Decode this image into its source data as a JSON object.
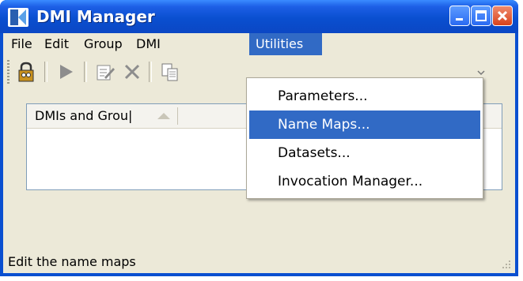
{
  "window": {
    "title": "DMI Manager"
  },
  "menubar": {
    "items": [
      "File",
      "Edit",
      "Group",
      "DMI",
      "Utilities"
    ],
    "active": "Utilities"
  },
  "table": {
    "column_header": "DMIs and Grou|"
  },
  "utilities_menu": {
    "items": [
      "Parameters...",
      "Name Maps...",
      "Datasets...",
      "Invocation Manager..."
    ],
    "highlighted": "Name Maps..."
  },
  "status": {
    "text": "Edit the name maps"
  },
  "colors": {
    "titlebar": "#0a4fd0",
    "highlight": "#316ac5",
    "client_bg": "#ece9d8"
  }
}
